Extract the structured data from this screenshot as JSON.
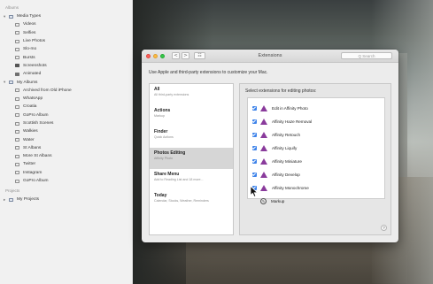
{
  "sidebar": {
    "albums_header": "Albums",
    "media_types": "Media Types",
    "media_items": [
      "Videos",
      "Selfies",
      "Live Photos",
      "Slo-mo",
      "Bursts",
      "Screenshots",
      "Animated"
    ],
    "my_albums": "My Albums",
    "album_items": [
      "Archived from Old iPhone",
      "WhatsApp",
      "Croatia",
      "GoPro Album",
      "Scottish Scenes",
      "Walkies",
      "Water",
      "St Albans",
      "More St Albans",
      "Twitter",
      "Instagram",
      "GoPro Album"
    ],
    "projects_header": "Projects",
    "my_projects": "My Projects"
  },
  "window": {
    "title": "Extensions",
    "search_placeholder": "Q Search",
    "nav_back": "<",
    "nav_forward": ">",
    "grid": "☷",
    "description": "Use Apple and third-party extensions to customize your Mac.",
    "categories": [
      {
        "name": "All",
        "sub": "All third-party extensions"
      },
      {
        "name": "Actions",
        "sub": "Markup"
      },
      {
        "name": "Finder",
        "sub": "Quick Actions"
      },
      {
        "name": "Photos Editing",
        "sub": "Affinity Photo"
      },
      {
        "name": "Share Menu",
        "sub": "Add to Reading List and 18 more..."
      },
      {
        "name": "Today",
        "sub": "Calendar, Stocks, Weather, Reminders"
      }
    ],
    "extensions_header": "Select extensions for editing photos:",
    "extensions": [
      {
        "label": "Edit in Affinity Photo",
        "checked": true
      },
      {
        "label": "Affinity Haze Removal",
        "checked": true
      },
      {
        "label": "Affinity Retouch",
        "checked": true
      },
      {
        "label": "Affinity Liquify",
        "checked": true
      },
      {
        "label": "Affinity Miniature",
        "checked": true
      },
      {
        "label": "Affinity Develop",
        "checked": true
      },
      {
        "label": "Affinity Monochrome",
        "checked": true
      }
    ],
    "markup": {
      "label": "Markup",
      "icon": "markup-icon"
    },
    "help": "?"
  },
  "colors": {
    "checkbox": "#3f84ea",
    "affinity_icon": "#8a3b9c",
    "close": "#fc605b",
    "minimize": "#fdbc40",
    "zoom": "#34c84a"
  }
}
